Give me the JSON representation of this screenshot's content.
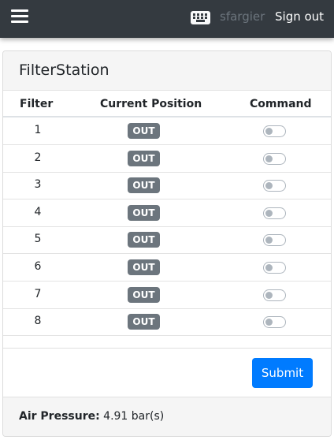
{
  "navbar": {
    "menu_icon": "hamburger-menu-icon",
    "keyboard_icon": "keyboard-icon",
    "username": "sfargier",
    "signout_label": "Sign out"
  },
  "card": {
    "title": "FilterStation",
    "table": {
      "headers": [
        "Filter",
        "Current Position",
        "Command"
      ],
      "rows": [
        {
          "filter": "1",
          "position": "OUT",
          "command_on": false
        },
        {
          "filter": "2",
          "position": "OUT",
          "command_on": false
        },
        {
          "filter": "3",
          "position": "OUT",
          "command_on": false
        },
        {
          "filter": "4",
          "position": "OUT",
          "command_on": false
        },
        {
          "filter": "5",
          "position": "OUT",
          "command_on": false
        },
        {
          "filter": "6",
          "position": "OUT",
          "command_on": false
        },
        {
          "filter": "7",
          "position": "OUT",
          "command_on": false
        },
        {
          "filter": "8",
          "position": "OUT",
          "command_on": false
        }
      ]
    },
    "submit_label": "Submit",
    "footer": {
      "pressure_label": "Air Pressure:",
      "pressure_value": "4.91 bar(s)"
    }
  },
  "colors": {
    "navbar_bg": "#343a40",
    "primary": "#007bff",
    "badge_bg": "#6c757d"
  }
}
